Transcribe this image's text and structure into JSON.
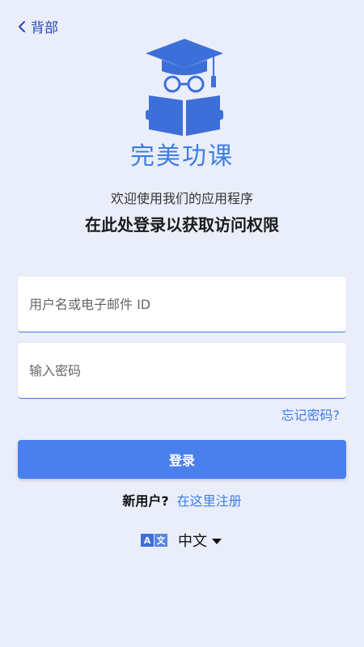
{
  "header": {
    "back_label": "背部"
  },
  "brand": {
    "name": "完美功课"
  },
  "welcome": {
    "line1": "欢迎使用我们的应用程序",
    "line2": "在此处登录以获取访问权限"
  },
  "form": {
    "username_placeholder": "用户名或电子邮件 ID",
    "password_placeholder": "输入密码",
    "forgot_label": "忘记密码?",
    "login_label": "登录"
  },
  "register": {
    "question": "新用户?",
    "link_label": "在这里注册"
  },
  "language": {
    "icon_left": "A",
    "icon_right": "文",
    "selected": "中文"
  },
  "colors": {
    "background": "#eaeefa",
    "accent": "#3d7de4",
    "button": "#4a7fee",
    "dark_blue": "#2546b8"
  },
  "icons": [
    "chevron-left-icon",
    "graduate-reader-logo",
    "translate-icon",
    "caret-down-icon"
  ]
}
